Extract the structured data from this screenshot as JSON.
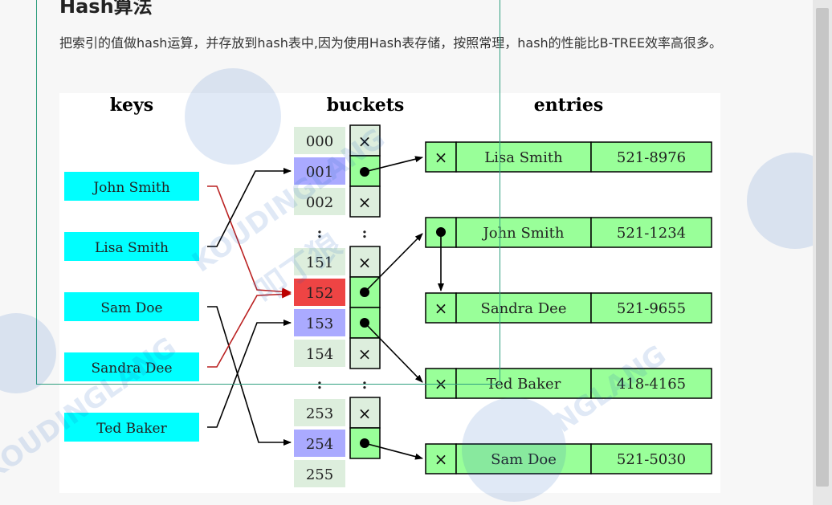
{
  "article": {
    "title": "Hash算法",
    "paragraph": "把索引的值做hash运算，并存放到hash表中,因为使用Hash表存储，按照常理，hash的性能比B-TREE效率高很多。"
  },
  "diagram": {
    "headers": {
      "keys": "keys",
      "buckets": "buckets",
      "entries": "entries"
    },
    "keys": [
      "John Smith",
      "Lisa Smith",
      "Sam Doe",
      "Sandra Dee",
      "Ted Baker"
    ],
    "buckets": [
      "000",
      "001",
      "002",
      ":",
      "151",
      "152",
      "153",
      "154",
      ":",
      "253",
      "254",
      "255"
    ],
    "entries": [
      {
        "name": "Lisa Smith",
        "phone": "521-8976"
      },
      {
        "name": "John Smith",
        "phone": "521-1234"
      },
      {
        "name": "Sandra Dee",
        "phone": "521-9655"
      },
      {
        "name": "Ted Baker",
        "phone": "418-4165"
      },
      {
        "name": "Sam Doe",
        "phone": "521-5030"
      }
    ],
    "null_symbol": "×",
    "colors": {
      "key": "#00ffff",
      "bucket": "#ddeedd",
      "bucket_used": "#aaaaff",
      "bucket_collision": "#ee4444",
      "entry": "#99ff99",
      "arrow_red": "#bb2222",
      "arrow_black": "#000000"
    }
  },
  "watermark": {
    "text": "KOUDINGLANG",
    "chinese": "叩丁狼"
  }
}
